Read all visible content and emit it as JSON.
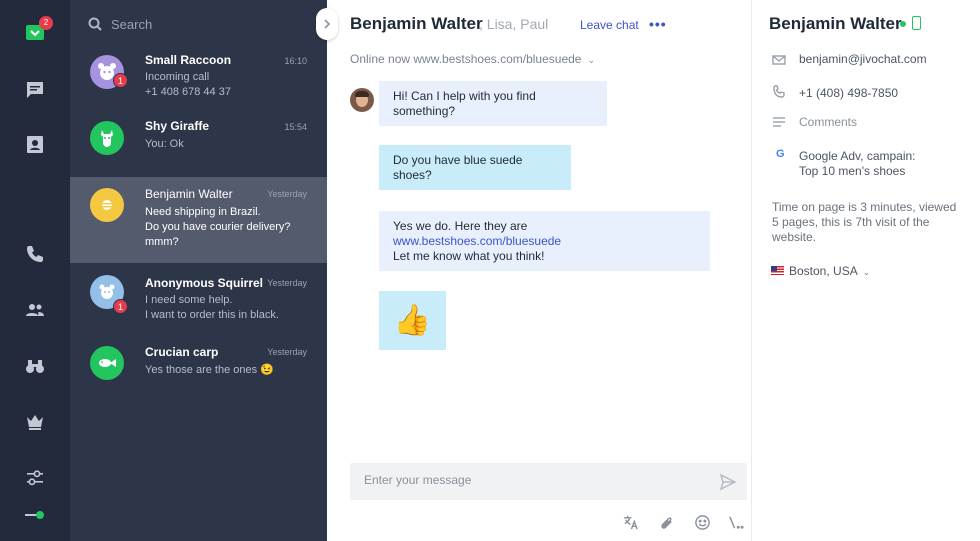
{
  "rail": {
    "inbox_badge": "2"
  },
  "search": {
    "placeholder": "Search"
  },
  "chats": [
    {
      "name": "Small Raccoon",
      "time": "16:10",
      "preview": "Incoming call\n+1 408 678 44 37",
      "badge": "1",
      "avatar_color": "#a792e0"
    },
    {
      "name": "Shy Giraffe",
      "time": "15:54",
      "preview": "You: Ok",
      "badge": "",
      "avatar_color": "#22c55e"
    },
    {
      "name": "Benjamin Walter",
      "time": "Yesterday",
      "preview": "Need shipping in Brazil.\nDo you have courier delivery?\nmmm?",
      "badge": "",
      "avatar_color": "#f5c842"
    },
    {
      "name": "Anonymous Squirrel",
      "time": "Yesterday",
      "preview": "I need some help.\nI want to order this in black.",
      "badge": "1",
      "avatar_color": "#94bfe8"
    },
    {
      "name": "Crucian carp",
      "time": "Yesterday",
      "preview": "Yes those are the ones 😉",
      "badge": "",
      "avatar_color": "#22c55e"
    }
  ],
  "conversation": {
    "title": "Benjamin Walter",
    "participants": ", Lisa, Paul",
    "leave_label": "Leave chat",
    "more_label": "•••",
    "status": "Online now www.bestshoes.com/bluesuede",
    "messages": [
      {
        "from": "agent",
        "text": "Hi! Can I help with you find something?"
      },
      {
        "from": "visitor",
        "text": "Do you have blue suede shoes?"
      },
      {
        "from": "agent",
        "line1": "Yes we do. Here they are ",
        "link": "www.bestshoes.com/bluesuede",
        "line2": "Let me know what you think!"
      },
      {
        "from": "agent",
        "emoji": "👍"
      }
    ],
    "composer_placeholder": "Enter your message"
  },
  "visitor": {
    "name": "Benjamin Walter",
    "email": "benjamin@jivochat.com",
    "phone": "+1 (408) 498-7850",
    "comments": "Comments",
    "source": "Google Adv, campain:\nTop 10 men's shoes",
    "visit_info": "Time on page is 3 minutes, viewed 5 pages, this is 7th visit of the website.",
    "location": "Boston, USA"
  },
  "colors": {
    "rail_bg": "#232a3b",
    "list_bg": "#2d3548",
    "active_row": "#535b6c",
    "accent": "#3b55c7",
    "online": "#22c55e",
    "badge": "#e73c4b"
  }
}
